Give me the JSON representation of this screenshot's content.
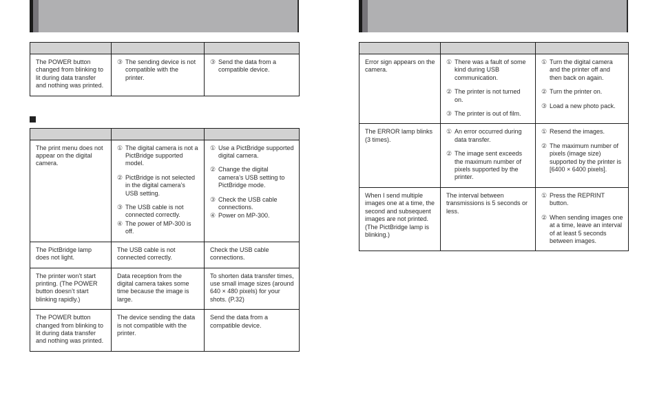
{
  "page": {
    "left_column": {
      "header_band": {
        "title": ""
      },
      "table_continued": {
        "columns": [
          "",
          "",
          ""
        ],
        "rows": [
          {
            "symptom": "The POWER button changed from blinking to lit during data transfer and nothing was printed.",
            "cause": {
              "items": [
                {
                  "marker": "③",
                  "text": "The sending device is not compatible with the printer."
                }
              ]
            },
            "remedy": {
              "items": [
                {
                  "marker": "③",
                  "text": "Send the data from a compatible device."
                }
              ]
            }
          }
        ]
      },
      "section_bullet": {
        "label": ""
      },
      "table_main": {
        "columns": [
          "",
          "",
          ""
        ],
        "rows": [
          {
            "symptom": "The print menu does not appear on the digital camera.",
            "cause": {
              "items": [
                {
                  "marker": "①",
                  "text": "The digital camera is not a PictBridge supported model."
                },
                {
                  "marker": "②",
                  "text": "PictBridge is not selected in the digital camera’s USB setting."
                },
                {
                  "marker": "③",
                  "text": "The USB cable is not connected correctly.",
                  "tight": true
                },
                {
                  "marker": "④",
                  "text": "The power of MP-300 is off.",
                  "tight": true
                }
              ]
            },
            "remedy": {
              "items": [
                {
                  "marker": "①",
                  "text": "Use a PictBridge supported digital camera."
                },
                {
                  "marker": "②",
                  "text": "Change the digital camera’s USB setting to PictBridge mode."
                },
                {
                  "marker": "③",
                  "text": "Check the USB cable connections.",
                  "tight": true
                },
                {
                  "marker": "④",
                  "text": "Power on MP-300.",
                  "tight": true
                }
              ]
            }
          },
          {
            "symptom": "The PictBridge lamp does not light.",
            "cause": {
              "plain": "The USB cable is not connected correctly."
            },
            "remedy": {
              "plain": "Check the USB cable connections."
            }
          },
          {
            "symptom": "The printer won’t start printing. (The POWER button doesn’t start blinking rapidly.)",
            "cause": {
              "plain": "Data reception from the digital camera takes some time because the image is large."
            },
            "remedy": {
              "plain": "To shorten data transfer times, use small image sizes (around 640 × 480 pixels) for your shots. (P.32)"
            }
          },
          {
            "symptom": "The POWER button changed from blinking to lit during data transfer and nothing was printed.",
            "cause": {
              "plain": "The device sending the data is not compatible with the printer."
            },
            "remedy": {
              "plain": "Send the data from a compatible device."
            }
          }
        ]
      }
    },
    "right_column": {
      "header_band": {
        "title": ""
      },
      "table_main": {
        "columns": [
          "",
          "",
          ""
        ],
        "rows": [
          {
            "symptom": "Error sign appears on the camera.",
            "cause": {
              "items": [
                {
                  "marker": "①",
                  "text": "There was a fault of some kind during USB communication."
                },
                {
                  "marker": "②",
                  "text": "The printer is not turned on."
                },
                {
                  "marker": "③",
                  "text": "The printer is out of film.",
                  "tight": true
                }
              ]
            },
            "remedy": {
              "items": [
                {
                  "marker": "①",
                  "text": "Turn the digital camera and the printer off and then back on again."
                },
                {
                  "marker": "②",
                  "text": "Turn the printer on."
                },
                {
                  "marker": "③",
                  "text": "Load a new photo pack."
                }
              ]
            }
          },
          {
            "symptom": "The ERROR lamp blinks (3 times).",
            "cause": {
              "items": [
                {
                  "marker": "①",
                  "text": "An error occurred during data transfer."
                },
                {
                  "marker": "②",
                  "text": "The image sent exceeds the maximum number of pixels supported by the printer.",
                  "tight": true
                }
              ]
            },
            "remedy": {
              "items": [
                {
                  "marker": "①",
                  "text": "Resend the images."
                },
                {
                  "marker": "②",
                  "text": "The maximum number of pixels (image size) supported by the printer is [6400 × 6400 pixels]."
                }
              ]
            }
          },
          {
            "symptom": "When I send multiple images one at a time, the second and subsequent images are not printed. (The PictBridge lamp is blinking.)",
            "cause": {
              "plain": "The interval between transmissions is 5 seconds or less."
            },
            "remedy": {
              "items": [
                {
                  "marker": "①",
                  "text": "Press the REPRINT button."
                },
                {
                  "marker": "②",
                  "text": "When sending images one at a time, leave an interval of at least 5 seconds between images.",
                  "tight": true
                }
              ]
            }
          }
        ]
      }
    }
  },
  "colors": {
    "band_fill": "#b0b0b2",
    "band_accent": "#77757a",
    "band_edge": "#1a1a1a",
    "table_header": "#d2d2d2",
    "rule": "#1c1c1c",
    "text": "#2a2a2a"
  }
}
